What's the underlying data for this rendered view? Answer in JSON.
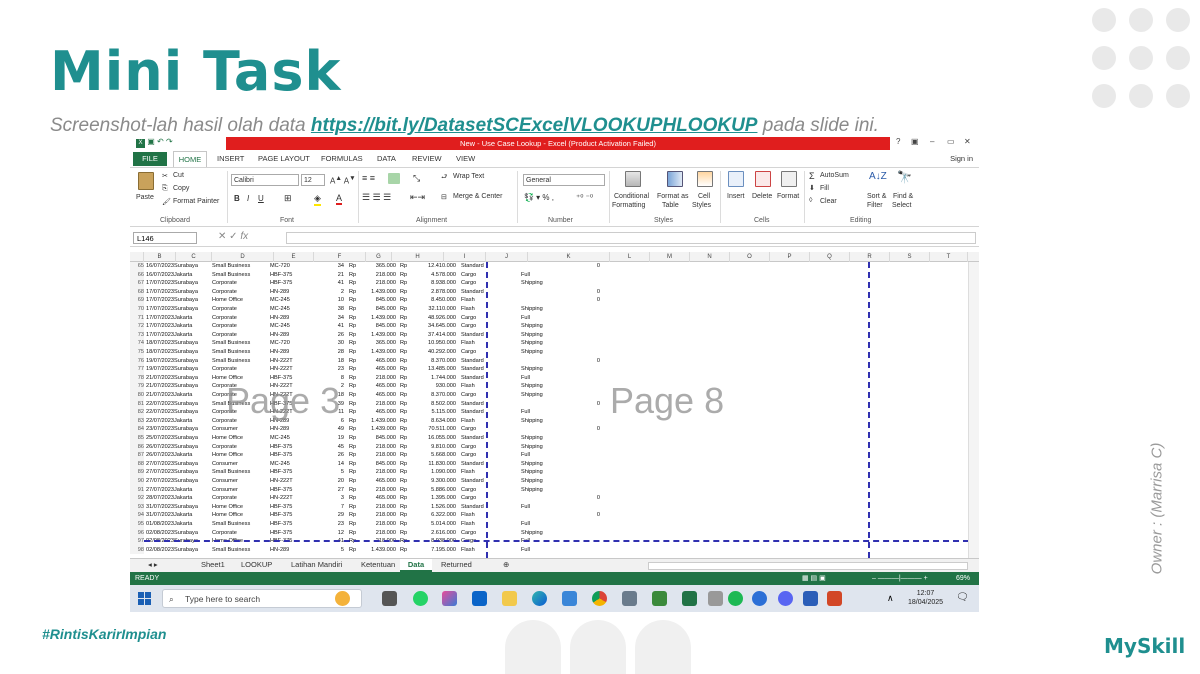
{
  "slide": {
    "title": "Mini Task",
    "subtitle_prefix": "Screenshot-lah hasil olah data ",
    "link": "https://bit.ly/DatasetSCExcelVLOOKUPHLOOKUP",
    "subtitle_suffix": " pada slide ini.",
    "owner": "Owner : (Marrisa C)",
    "hashtag": "#RintisKarirImpian",
    "brand": "MySkill",
    "colors": {
      "accent": "#1f8f8f",
      "excel_green": "#217346",
      "title_red": "#e01e1e"
    }
  },
  "excel": {
    "window_title": "New - Use Case Lookup - Excel (Product Activation Failed)",
    "sign_in": "Sign in",
    "tabs": [
      "FILE",
      "HOME",
      "INSERT",
      "PAGE LAYOUT",
      "FORMULAS",
      "DATA",
      "REVIEW",
      "VIEW"
    ],
    "ribbon": {
      "clipboard": {
        "paste": "Paste",
        "cut": "Cut",
        "copy": "Copy",
        "format_painter": "Format Painter",
        "label": "Clipboard"
      },
      "font": {
        "name": "Calibri",
        "size": "12",
        "label": "Font"
      },
      "alignment": {
        "wrap": "Wrap Text",
        "merge": "Merge & Center",
        "label": "Alignment"
      },
      "number": {
        "format": "General",
        "label": "Number"
      },
      "styles": {
        "conditional": "Conditional",
        "formatting": "Formatting",
        "format_as": "Format as",
        "table": "Table",
        "cell": "Cell",
        "cell_styles": "Styles",
        "label": "Styles"
      },
      "cells": {
        "insert": "Insert",
        "delete": "Delete",
        "format": "Format",
        "label": "Cells"
      },
      "editing": {
        "autosum": "AutoSum",
        "fill": "Fill",
        "clear": "Clear",
        "sort": "Sort &",
        "filter": "Filter",
        "find": "Find &",
        "select": "Select",
        "label": "Editing"
      }
    },
    "name_box": "L146",
    "fx": "fx",
    "columns": [
      "B",
      "C",
      "D",
      "E",
      "F",
      "G",
      "H",
      "I",
      "J",
      "K",
      "L",
      "M",
      "N",
      "O",
      "P",
      "Q",
      "R",
      "S",
      "T"
    ],
    "rows": [
      [
        "65",
        "16/07/2023",
        "Surabaya",
        "Small Business",
        "MC-720",
        "34",
        "Rp",
        "365.000",
        "Rp",
        "12.410.000",
        "Standard",
        "",
        "0"
      ],
      [
        "66",
        "16/07/2023",
        "Jakarta",
        "Small Business",
        "HBF-375",
        "21",
        "Rp",
        "218.000",
        "Rp",
        "4.578.000",
        "Cargo",
        "Full",
        ""
      ],
      [
        "67",
        "17/07/2023",
        "Surabaya",
        "Corporate",
        "HBF-375",
        "41",
        "Rp",
        "218.000",
        "Rp",
        "8.938.000",
        "Cargo",
        "Shipping",
        ""
      ],
      [
        "68",
        "17/07/2023",
        "Surabaya",
        "Corporate",
        "HN-289",
        "2",
        "Rp",
        "1.439.000",
        "Rp",
        "2.878.000",
        "Standard",
        "",
        "0"
      ],
      [
        "69",
        "17/07/2023",
        "Surabaya",
        "Home Office",
        "MC-245",
        "10",
        "Rp",
        "845.000",
        "Rp",
        "8.450.000",
        "Flash",
        "",
        "0"
      ],
      [
        "70",
        "17/07/2023",
        "Surabaya",
        "Corporate",
        "MC-245",
        "38",
        "Rp",
        "845.000",
        "Rp",
        "32.110.000",
        "Flash",
        "Shipping",
        ""
      ],
      [
        "71",
        "17/07/2023",
        "Jakarta",
        "Corporate",
        "HN-289",
        "34",
        "Rp",
        "1.439.000",
        "Rp",
        "48.926.000",
        "Cargo",
        "Full",
        ""
      ],
      [
        "72",
        "17/07/2023",
        "Jakarta",
        "Corporate",
        "MC-245",
        "41",
        "Rp",
        "845.000",
        "Rp",
        "34.645.000",
        "Cargo",
        "Shipping",
        ""
      ],
      [
        "73",
        "17/07/2023",
        "Jakarta",
        "Corporate",
        "HN-289",
        "26",
        "Rp",
        "1.439.000",
        "Rp",
        "37.414.000",
        "Standard",
        "Shipping",
        ""
      ],
      [
        "74",
        "18/07/2023",
        "Surabaya",
        "Small Business",
        "MC-720",
        "30",
        "Rp",
        "365.000",
        "Rp",
        "10.950.000",
        "Flash",
        "Shipping",
        ""
      ],
      [
        "75",
        "18/07/2023",
        "Surabaya",
        "Small Business",
        "HN-289",
        "28",
        "Rp",
        "1.439.000",
        "Rp",
        "40.292.000",
        "Cargo",
        "Shipping",
        ""
      ],
      [
        "76",
        "19/07/2023",
        "Surabaya",
        "Small Business",
        "HN-222T",
        "18",
        "Rp",
        "465.000",
        "Rp",
        "8.370.000",
        "Standard",
        "",
        "0"
      ],
      [
        "77",
        "19/07/2023",
        "Surabaya",
        "Corporate",
        "HN-222T",
        "23",
        "Rp",
        "465.000",
        "Rp",
        "13.485.000",
        "Standard",
        "Shipping",
        ""
      ],
      [
        "78",
        "21/07/2023",
        "Surabaya",
        "Home Office",
        "HBF-375",
        "8",
        "Rp",
        "218.000",
        "Rp",
        "1.744.000",
        "Standard",
        "Full",
        ""
      ],
      [
        "79",
        "21/07/2023",
        "Surabaya",
        "Corporate",
        "HN-222T",
        "2",
        "Rp",
        "465.000",
        "Rp",
        "930.000",
        "Flash",
        "Shipping",
        ""
      ],
      [
        "80",
        "21/07/2023",
        "Jakarta",
        "Corporate",
        "HN-222T",
        "18",
        "Rp",
        "465.000",
        "Rp",
        "8.370.000",
        "Cargo",
        "Shipping",
        ""
      ],
      [
        "81",
        "22/07/2023",
        "Surabaya",
        "Small Business",
        "HBF-375",
        "39",
        "Rp",
        "218.000",
        "Rp",
        "8.502.000",
        "Standard",
        "",
        "0"
      ],
      [
        "82",
        "22/07/2023",
        "Surabaya",
        "Corporate",
        "HN-222T",
        "11",
        "Rp",
        "465.000",
        "Rp",
        "5.115.000",
        "Standard",
        "Full",
        ""
      ],
      [
        "83",
        "22/07/2023",
        "Jakarta",
        "Corporate",
        "HN-289",
        "6",
        "Rp",
        "1.439.000",
        "Rp",
        "8.634.000",
        "Flash",
        "Shipping",
        ""
      ],
      [
        "84",
        "23/07/2023",
        "Surabaya",
        "Consumer",
        "HN-289",
        "49",
        "Rp",
        "1.439.000",
        "Rp",
        "70.511.000",
        "Cargo",
        "",
        "0"
      ],
      [
        "85",
        "25/07/2023",
        "Surabaya",
        "Home Office",
        "MC-245",
        "19",
        "Rp",
        "845.000",
        "Rp",
        "16.055.000",
        "Standard",
        "Shipping",
        ""
      ],
      [
        "86",
        "26/07/2023",
        "Surabaya",
        "Corporate",
        "HBF-375",
        "45",
        "Rp",
        "218.000",
        "Rp",
        "9.810.000",
        "Cargo",
        "Shipping",
        ""
      ],
      [
        "87",
        "26/07/2023",
        "Jakarta",
        "Home Office",
        "HBF-375",
        "26",
        "Rp",
        "218.000",
        "Rp",
        "5.668.000",
        "Cargo",
        "Full",
        ""
      ],
      [
        "88",
        "27/07/2023",
        "Surabaya",
        "Consumer",
        "MC-245",
        "14",
        "Rp",
        "845.000",
        "Rp",
        "11.830.000",
        "Standard",
        "Shipping",
        ""
      ],
      [
        "89",
        "27/07/2023",
        "Surabaya",
        "Small Business",
        "HBF-375",
        "5",
        "Rp",
        "218.000",
        "Rp",
        "1.090.000",
        "Flash",
        "Shipping",
        ""
      ],
      [
        "90",
        "27/07/2023",
        "Surabaya",
        "Consumer",
        "HN-222T",
        "20",
        "Rp",
        "465.000",
        "Rp",
        "9.300.000",
        "Standard",
        "Shipping",
        ""
      ],
      [
        "91",
        "27/07/2023",
        "Jakarta",
        "Consumer",
        "HBF-375",
        "27",
        "Rp",
        "218.000",
        "Rp",
        "5.886.000",
        "Cargo",
        "Shipping",
        ""
      ],
      [
        "92",
        "28/07/2023",
        "Jakarta",
        "Corporate",
        "HN-222T",
        "3",
        "Rp",
        "465.000",
        "Rp",
        "1.395.000",
        "Cargo",
        "",
        "0"
      ],
      [
        "93",
        "31/07/2023",
        "Surabaya",
        "Home Office",
        "HBF-375",
        "7",
        "Rp",
        "218.000",
        "Rp",
        "1.526.000",
        "Standard",
        "Full",
        ""
      ],
      [
        "94",
        "31/07/2023",
        "Jakarta",
        "Home Office",
        "HBF-375",
        "29",
        "Rp",
        "218.000",
        "Rp",
        "6.322.000",
        "Flash",
        "",
        "0"
      ],
      [
        "95",
        "01/08/2023",
        "Jakarta",
        "Small Business",
        "HBF-375",
        "23",
        "Rp",
        "218.000",
        "Rp",
        "5.014.000",
        "Flash",
        "Full",
        ""
      ],
      [
        "96",
        "02/08/2023",
        "Surabaya",
        "Corporate",
        "HBF-375",
        "12",
        "Rp",
        "218.000",
        "Rp",
        "2.616.000",
        "Cargo",
        "Shipping",
        ""
      ],
      [
        "97",
        "02/08/2023",
        "Surabaya",
        "Home Office",
        "HBF-375",
        "41",
        "Rp",
        "218.000",
        "Rp",
        "8.938.000",
        "Cargo",
        "Full",
        ""
      ],
      [
        "98",
        "02/08/2023",
        "Surabaya",
        "Small Business",
        "HN-289",
        "5",
        "Rp",
        "1.439.000",
        "Rp",
        "7.195.000",
        "Flash",
        "Full",
        ""
      ]
    ],
    "watermarks": [
      "Page 3",
      "Page 8"
    ],
    "sheet_tabs": [
      "Sheet1",
      "LOOKUP",
      "Latihan Mandiri",
      "Ketentuan",
      "Data",
      "Returned"
    ],
    "status": {
      "ready": "READY",
      "zoom": "69%"
    },
    "taskbar": {
      "search_placeholder": "Type here to search",
      "time": "12:07",
      "date": "18/04/2025"
    }
  }
}
